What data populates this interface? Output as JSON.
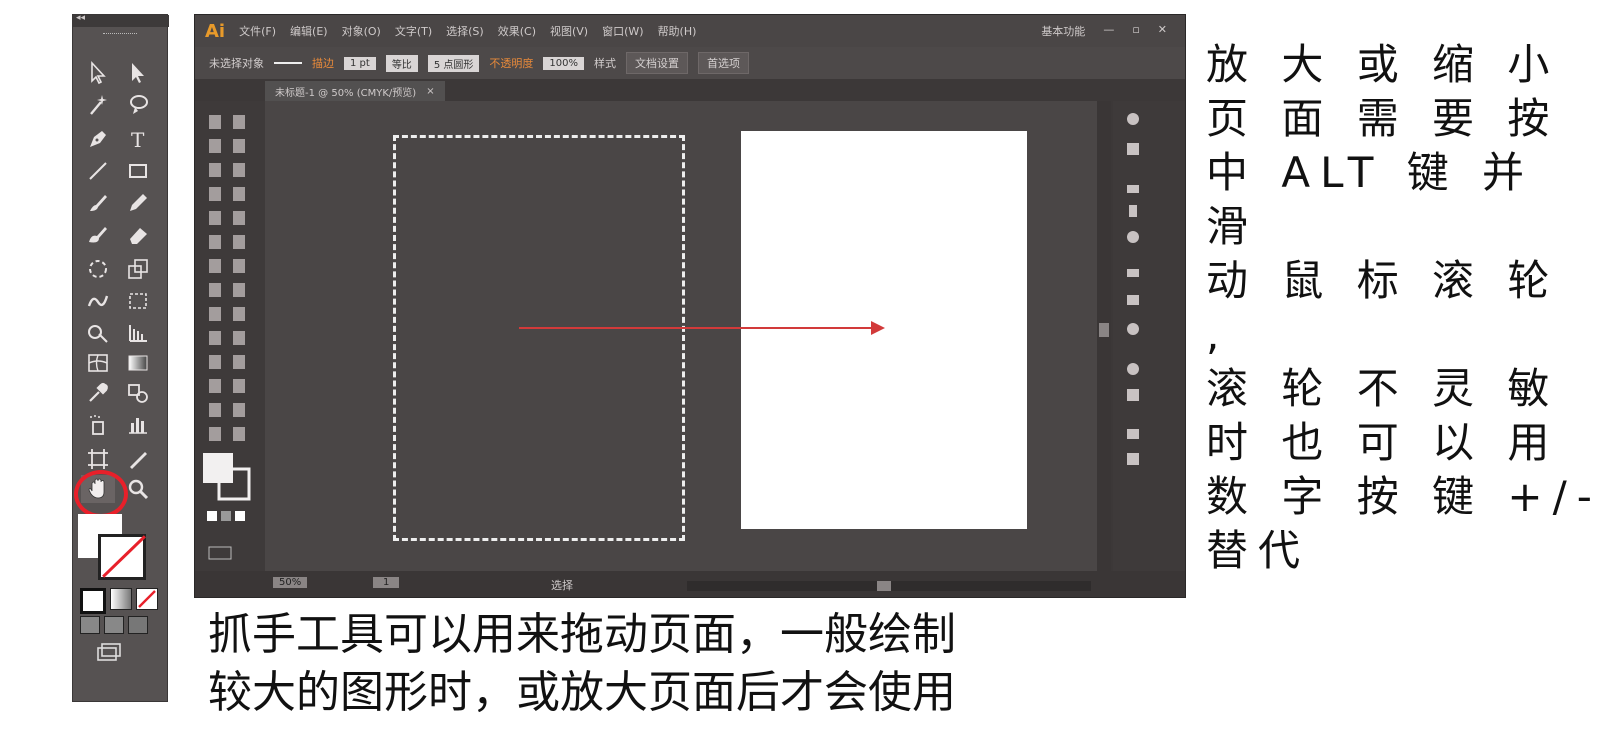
{
  "app": {
    "logo": "Ai",
    "menus": [
      "文件(F)",
      "编辑(E)",
      "对象(O)",
      "文字(T)",
      "选择(S)",
      "效果(C)",
      "视图(V)",
      "窗口(W)",
      "帮助(H)"
    ],
    "workspace": "基本功能",
    "window_controls": [
      "—",
      "▫",
      "✕"
    ]
  },
  "control_bar": {
    "selection": "未选择对象",
    "stroke_label": "描边",
    "stroke_value": "1 pt",
    "line_style": "等比",
    "brush": "5 点圆形",
    "opacity_label": "不透明度",
    "opacity_value": "100%",
    "style_label": "样式",
    "doc_setup": "文档设置",
    "preferences": "首选项"
  },
  "document_tab": {
    "title": "未标题-1 @ 50% (CMYK/预览)",
    "close": "×"
  },
  "status_bar": {
    "zoom": "50%",
    "page": "1",
    "tool": "选择"
  },
  "captions": {
    "right": "放 大 或 缩 小\n页 面 需 要 按\n中 ALT 键 并 滑\n动 鼠 标 滚 轮 ,\n滚 轮 不 灵 敏\n时 也 可 以 用\n数 字 按 键 +/-\n替代",
    "bottom": "抓手工具可以用来拖动页面，一般绘制\n较大的图形时，或放大页面后才会使用"
  },
  "colors": {
    "highlight_circle": "#e8202a",
    "arrow": "#d23a3a",
    "panel_bg": "#4a4646"
  },
  "icons": [
    "select-arrow-icon",
    "direct-select-icon",
    "magic-wand-icon",
    "lasso-icon",
    "pen-icon",
    "type-icon",
    "line-icon",
    "rectangle-icon",
    "brush-icon",
    "pencil-icon",
    "blob-brush-icon",
    "eraser-icon",
    "rotate-icon",
    "scale-icon",
    "warp-icon",
    "free-transform-icon",
    "shape-builder-icon",
    "perspective-grid-icon",
    "mesh-icon",
    "gradient-icon",
    "eyedropper-icon",
    "blend-icon",
    "symbol-sprayer-icon",
    "column-graph-icon",
    "artboard-icon",
    "slice-icon",
    "hand-icon",
    "zoom-icon"
  ]
}
